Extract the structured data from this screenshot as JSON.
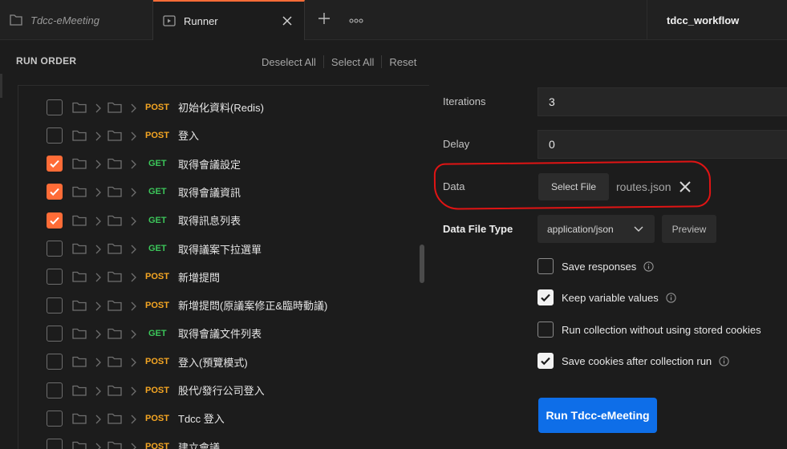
{
  "tabs": [
    {
      "label": "Tdcc-eMeeting",
      "icon": "collection-icon",
      "active": false
    },
    {
      "label": "Runner",
      "icon": "runner-icon",
      "active": true
    }
  ],
  "workspace_name": "tdcc_workflow",
  "run_order": {
    "title": "RUN ORDER",
    "actions": {
      "deselect_all": "Deselect All",
      "select_all": "Select All",
      "reset": "Reset"
    },
    "requests": [
      {
        "method": "POST",
        "name": "初始化資料(Redis)",
        "checked": false
      },
      {
        "method": "POST",
        "name": "登入",
        "checked": false
      },
      {
        "method": "GET",
        "name": "取得會議設定",
        "checked": true
      },
      {
        "method": "GET",
        "name": "取得會議資訊",
        "checked": true
      },
      {
        "method": "GET",
        "name": "取得訊息列表",
        "checked": true
      },
      {
        "method": "GET",
        "name": "取得議案下拉選單",
        "checked": false
      },
      {
        "method": "POST",
        "name": "新增提問",
        "checked": false
      },
      {
        "method": "POST",
        "name": "新增提問(原議案修正&臨時動議)",
        "checked": false
      },
      {
        "method": "GET",
        "name": "取得會議文件列表",
        "checked": false
      },
      {
        "method": "POST",
        "name": "登入(預覽模式)",
        "checked": false
      },
      {
        "method": "POST",
        "name": "股代/發行公司登入",
        "checked": false
      },
      {
        "method": "POST",
        "name": "Tdcc 登入",
        "checked": false
      },
      {
        "method": "POST",
        "name": "建立會議",
        "checked": false
      }
    ]
  },
  "settings": {
    "iterations_label": "Iterations",
    "iterations_value": "3",
    "delay_label": "Delay",
    "delay_value": "0",
    "data_label": "Data",
    "select_file_label": "Select File",
    "file_name": "routes.json",
    "data_file_type_label": "Data File Type",
    "data_file_type_value": "application/json",
    "preview_label": "Preview"
  },
  "options": [
    {
      "label": "Save responses",
      "checked": false,
      "info": true
    },
    {
      "label": "Keep variable values",
      "checked": true,
      "info": true
    },
    {
      "label": "Run collection without using stored cookies",
      "checked": false,
      "info": false
    },
    {
      "label": "Save cookies after collection run",
      "checked": true,
      "info": true
    }
  ],
  "run_button_label": "Run Tdcc-eMeeting",
  "colors": {
    "accent": "#ff6c37",
    "run_button": "#0e6ee8",
    "post": "#f5a623",
    "get": "#3cc65a",
    "annotation": "#e11414"
  }
}
